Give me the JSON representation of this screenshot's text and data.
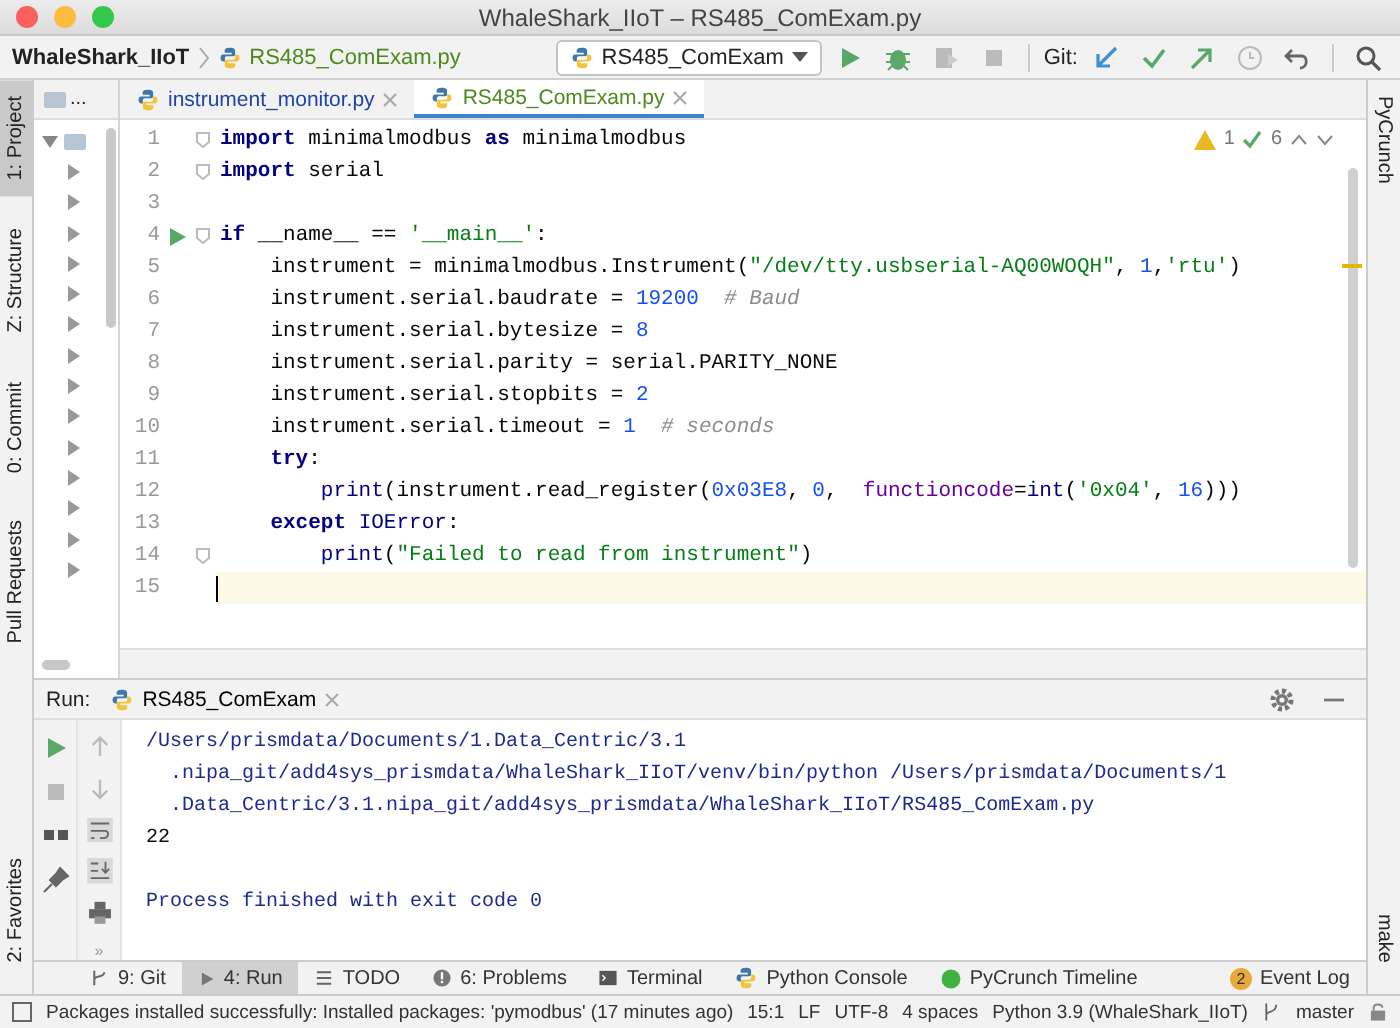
{
  "window": {
    "title": "WhaleShark_IIoT – RS485_ComExam.py"
  },
  "breadcrumb": [
    {
      "label": "WhaleShark_IIoT",
      "kind": "project"
    },
    {
      "label": "RS485_ComExam.py",
      "kind": "file"
    }
  ],
  "run_config": {
    "label": "RS485_ComExam"
  },
  "git_label": "Git:",
  "left_tool_tabs": [
    {
      "label": "1: Project",
      "selected": true
    },
    {
      "label": "Z: Structure",
      "selected": false
    },
    {
      "label": "0: Commit",
      "selected": false
    },
    {
      "label": "Pull Requests",
      "selected": false
    }
  ],
  "left_bottom_tool_tabs": [
    {
      "label": "2: Favorites",
      "selected": false
    }
  ],
  "right_tool_tabs": [
    {
      "label": "PyCrunch"
    }
  ],
  "right_bottom_tool_tabs": [
    {
      "label": "make"
    }
  ],
  "project_panel": {
    "header": "...",
    "tree": [
      {
        "expanded": true,
        "children": [
          {
            "expanded": false
          },
          {
            "expanded": false
          },
          {
            "expanded": false
          },
          {
            "expanded": false
          },
          {
            "expanded": false
          },
          {
            "expanded": false
          },
          {
            "expanded": false
          },
          {
            "expanded": false
          },
          {
            "expanded": false
          },
          {
            "expanded": false
          },
          {
            "expanded": false
          },
          {
            "expanded": false
          },
          {
            "expanded": false
          },
          {
            "expanded": false
          }
        ]
      }
    ]
  },
  "editor_tabs": [
    {
      "label": "instrument_monitor.py",
      "selected": false,
      "color": "#2243a6"
    },
    {
      "label": "RS485_ComExam.py",
      "selected": true,
      "color": "#4d8a1d"
    }
  ],
  "inspections": {
    "warnings": "1",
    "weak_warnings": "6"
  },
  "code_lines": [
    {
      "number": "1",
      "fold": true,
      "run": false,
      "current": false,
      "tokens": [
        {
          "kind": "keyword",
          "text": "import"
        },
        {
          "kind": "plain",
          "text": " minimalmodbus "
        },
        {
          "kind": "keyword",
          "text": "as"
        },
        {
          "kind": "plain",
          "text": " minimalmodbus"
        }
      ]
    },
    {
      "number": "2",
      "fold": true,
      "run": false,
      "current": false,
      "tokens": [
        {
          "kind": "keyword",
          "text": "import"
        },
        {
          "kind": "plain",
          "text": " serial"
        }
      ]
    },
    {
      "number": "3",
      "fold": false,
      "run": false,
      "current": false
    },
    {
      "number": "4",
      "fold": true,
      "run": true,
      "current": false,
      "tokens": [
        {
          "kind": "keyword",
          "text": "if"
        },
        {
          "kind": "plain",
          "text": " __name__ == "
        },
        {
          "kind": "string",
          "text": "'__main__'"
        },
        {
          "kind": "plain",
          "text": ":"
        }
      ]
    },
    {
      "number": "5",
      "fold": false,
      "run": false,
      "current": false,
      "tokens": [
        {
          "kind": "plain",
          "text": "    instrument = minimalmodbus.Instrument("
        },
        {
          "kind": "string",
          "text": "\"/dev/tty.usbserial-AQ00WOQH\""
        },
        {
          "kind": "plain",
          "text": ", "
        },
        {
          "kind": "number",
          "text": "1"
        },
        {
          "kind": "plain",
          "text": ","
        },
        {
          "kind": "string",
          "text": "'rtu'"
        },
        {
          "kind": "plain",
          "text": ")"
        }
      ]
    },
    {
      "number": "6",
      "fold": false,
      "run": false,
      "current": false,
      "tokens": [
        {
          "kind": "plain",
          "text": "    instrument.serial.baudrate = "
        },
        {
          "kind": "number",
          "text": "19200"
        },
        {
          "kind": "comment",
          "text": "  # Baud"
        }
      ]
    },
    {
      "number": "7",
      "fold": false,
      "run": false,
      "current": false,
      "tokens": [
        {
          "kind": "plain",
          "text": "    instrument.serial.bytesize = "
        },
        {
          "kind": "number",
          "text": "8"
        }
      ]
    },
    {
      "number": "8",
      "fold": false,
      "run": false,
      "current": false,
      "tokens": [
        {
          "kind": "plain",
          "text": "    instrument.serial.parity = serial.PARITY_NONE"
        }
      ]
    },
    {
      "number": "9",
      "fold": false,
      "run": false,
      "current": false,
      "tokens": [
        {
          "kind": "plain",
          "text": "    instrument.serial.stopbits = "
        },
        {
          "kind": "number",
          "text": "2"
        }
      ]
    },
    {
      "number": "10",
      "fold": false,
      "run": false,
      "current": false,
      "tokens": [
        {
          "kind": "plain",
          "text": "    instrument.serial.timeout = "
        },
        {
          "kind": "number",
          "text": "1"
        },
        {
          "kind": "comment",
          "text": "  # seconds"
        }
      ]
    },
    {
      "number": "11",
      "fold": false,
      "run": false,
      "current": false,
      "tokens": [
        {
          "kind": "keyword",
          "text": "    try"
        },
        {
          "kind": "plain",
          "text": ":"
        }
      ]
    },
    {
      "number": "12",
      "fold": false,
      "run": false,
      "current": false,
      "tokens": [
        {
          "kind": "builtin",
          "text": "        print"
        },
        {
          "kind": "plain",
          "text": "(instrument.read_register("
        },
        {
          "kind": "number",
          "text": "0x03E8"
        },
        {
          "kind": "plain",
          "text": ", "
        },
        {
          "kind": "number",
          "text": "0"
        },
        {
          "kind": "plain",
          "text": ",  "
        },
        {
          "kind": "param",
          "text": "functioncode"
        },
        {
          "kind": "plain",
          "text": "="
        },
        {
          "kind": "builtin",
          "text": "int"
        },
        {
          "kind": "plain",
          "text": "("
        },
        {
          "kind": "string",
          "text": "'0x04'"
        },
        {
          "kind": "plain",
          "text": ", "
        },
        {
          "kind": "number",
          "text": "16"
        },
        {
          "kind": "plain",
          "text": ")))"
        }
      ]
    },
    {
      "number": "13",
      "fold": false,
      "run": false,
      "current": false,
      "tokens": [
        {
          "kind": "keyword",
          "text": "    except"
        },
        {
          "kind": "builtin",
          "text": " IOError"
        },
        {
          "kind": "plain",
          "text": ":"
        }
      ]
    },
    {
      "number": "14",
      "fold": true,
      "run": false,
      "current": false,
      "tokens": [
        {
          "kind": "builtin",
          "text": "        print"
        },
        {
          "kind": "plain",
          "text": "("
        },
        {
          "kind": "string",
          "text": "\"Failed to read from instrument\""
        },
        {
          "kind": "plain",
          "text": ")"
        }
      ]
    },
    {
      "number": "15",
      "fold": false,
      "run": false,
      "current": true
    }
  ],
  "run_panel": {
    "label": "Run:",
    "tab": "RS485_ComExam",
    "output": [
      {
        "kind": "system",
        "text": "/Users/prismdata/Documents/1.Data_Centric/3.1"
      },
      {
        "kind": "system",
        "text": "  .nipa_git/add4sys_prismdata/WhaleShark_IIoT/venv/bin/python /Users/prismdata/Documents/1"
      },
      {
        "kind": "system",
        "text": "  .Data_Centric/3.1.nipa_git/add4sys_prismdata/WhaleShark_IIoT/RS485_ComExam.py"
      },
      {
        "kind": "stdout",
        "text": "22"
      },
      {
        "kind": "exit",
        "text": "Process finished with exit code 0"
      }
    ],
    "more": "»"
  },
  "bottom_tool_tabs": [
    {
      "label": "9: Git",
      "kind": "git",
      "selected": false
    },
    {
      "label": "4: Run",
      "kind": "run",
      "selected": true
    },
    {
      "label": "TODO",
      "kind": "todo",
      "selected": false
    },
    {
      "label": "6: Problems",
      "kind": "problems",
      "selected": false
    },
    {
      "label": "Terminal",
      "kind": "terminal",
      "selected": false
    },
    {
      "label": "Python Console",
      "kind": "console",
      "selected": false
    },
    {
      "label": "PyCrunch Timeline",
      "kind": "pycrunch",
      "selected": false
    }
  ],
  "event_log": {
    "label": "Event Log",
    "badge": "2"
  },
  "status_bar": {
    "message": "Packages installed successfully: Installed packages: 'pymodbus' (17 minutes ago)",
    "items": [
      "15:1",
      "LF",
      "UTF-8",
      "4 spaces",
      "Python 3.9 (WhaleShark_IIoT)"
    ],
    "branch": "master"
  }
}
